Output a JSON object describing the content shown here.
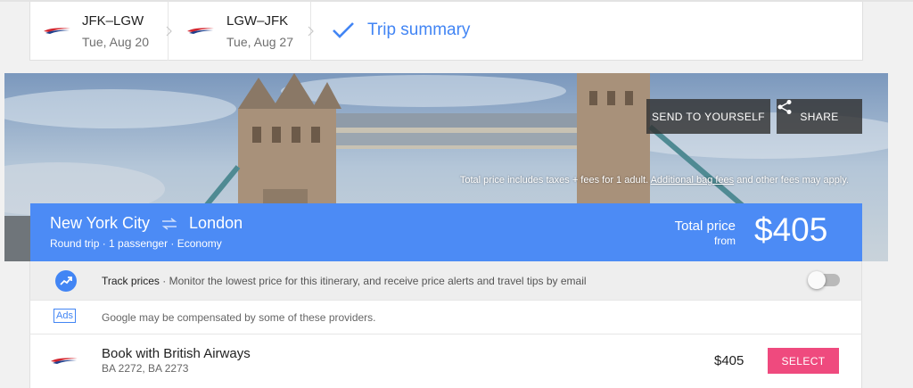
{
  "steps": [
    {
      "route": "JFK–LGW",
      "date": "Tue, Aug 20",
      "airline_icon": "british-airways-logo"
    },
    {
      "route": "LGW–JFK",
      "date": "Tue, Aug 27",
      "airline_icon": "british-airways-logo"
    },
    {
      "label": "Trip summary",
      "icon": "check-icon"
    }
  ],
  "hero": {
    "send_label": "SEND TO YOURSELF",
    "share_label": "SHARE",
    "note_prefix": "Total price includes taxes + fees for 1 adult.",
    "note_link": "Additional bag fees",
    "note_suffix": "and other fees may apply."
  },
  "summary": {
    "origin": "New York City",
    "destination": "London",
    "meta": "Round trip · 1 passenger · Economy",
    "total_label": "Total price",
    "from_label": "from",
    "price": "$405"
  },
  "track": {
    "title": "Track prices",
    "description": "Monitor the lowest price for this itinerary, and receive price alerts and travel tips by email",
    "enabled": false
  },
  "ads": {
    "badge": "Ads",
    "text": "Google may be compensated by some of these providers."
  },
  "booking": {
    "title": "Book with British Airways",
    "flights": "BA 2272, BA 2273",
    "price": "$405",
    "select_label": "SELECT"
  },
  "colors": {
    "accent": "#4285f4",
    "summary_bar": "#4c8bf5",
    "select_button": "#ef4a7e"
  }
}
